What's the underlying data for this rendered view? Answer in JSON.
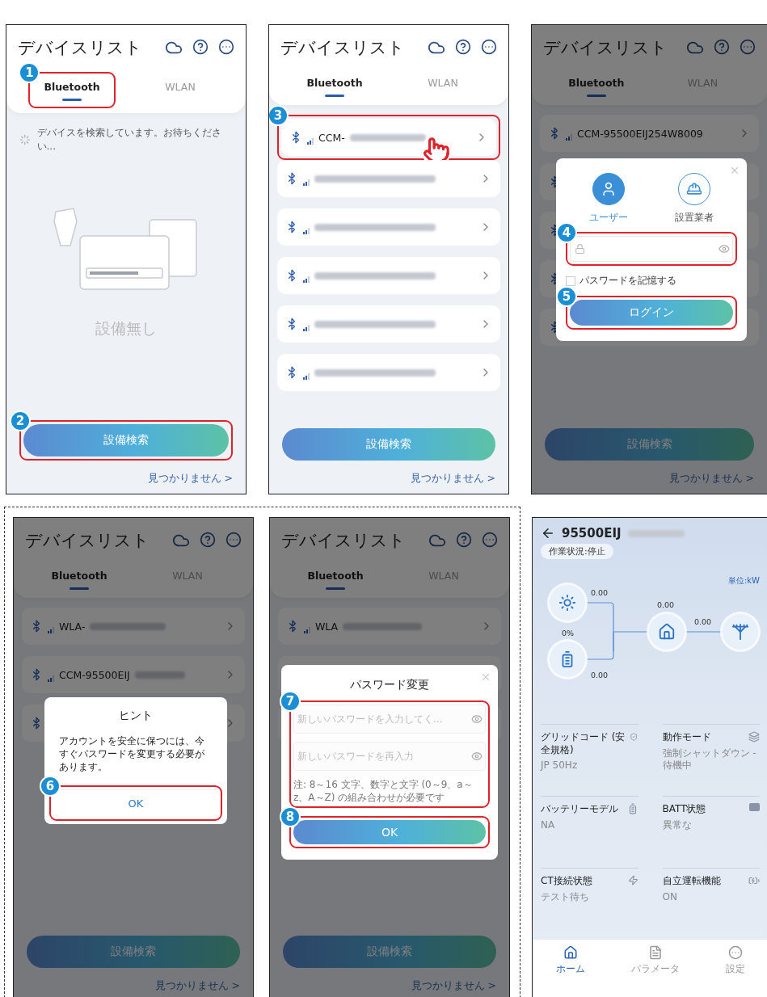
{
  "top_row": [
    {
      "kind": "device_list",
      "title": "デバイスリスト",
      "tabs": [
        {
          "label": "Bluetooth",
          "selected": true,
          "callout": "1"
        },
        {
          "label": "WLAN",
          "selected": false
        }
      ],
      "scanning_text": "デバイスを検索しています。お待ちください...",
      "empty_text": "設備無し",
      "search_button": {
        "label": "設備検索",
        "callout": "2"
      },
      "not_found_link": "見つかりません >"
    },
    {
      "kind": "device_list",
      "title": "デバイスリスト",
      "tabs": [
        {
          "label": "Bluetooth",
          "selected": true
        },
        {
          "label": "WLAN",
          "selected": false
        }
      ],
      "devices": [
        {
          "kind": "device",
          "name": "CCM-",
          "blurred": true,
          "callout": "3",
          "tapped": true
        },
        {
          "kind": "device",
          "blurred": true,
          "tapped": false
        },
        {
          "kind": "device",
          "blurred": true,
          "tapped": false
        },
        {
          "kind": "device",
          "blurred": true,
          "tapped": false
        },
        {
          "kind": "device",
          "blurred": true,
          "tapped": false
        },
        {
          "kind": "device",
          "blurred": true,
          "tapped": false
        }
      ],
      "search_button": {
        "label": "設備検索"
      },
      "not_found_link": "見つかりません >"
    },
    {
      "kind": "device_list",
      "title": "デバイスリスト",
      "tabs": [
        {
          "label": "Bluetooth",
          "selected": true
        },
        {
          "label": "WLAN",
          "selected": false
        }
      ],
      "devices": [
        {
          "kind": "device",
          "name": "CCM-95500EIJ254W8009",
          "blurred": false,
          "tapped": false
        },
        {
          "kind": "covered"
        },
        {
          "kind": "covered"
        },
        {
          "kind": "covered"
        },
        {
          "kind": "covered"
        }
      ],
      "search_button": {
        "label": "設備検索"
      },
      "not_found_link": "見つかりません >",
      "dialog": {
        "kind": "login",
        "roles": [
          {
            "label": "ユーザー",
            "selected": true
          },
          {
            "label": "設置業者",
            "selected": false
          }
        ],
        "password_field": {
          "callout": "4"
        },
        "remember": {
          "label": "パスワードを記憶する",
          "checked": false
        },
        "button": {
          "label": "ログイン",
          "callout": "5"
        }
      }
    }
  ],
  "bottom_row": {
    "grouped": [
      {
        "kind": "device_list",
        "title": "デバイスリスト",
        "tabs": [
          {
            "label": "Bluetooth",
            "selected": true
          },
          {
            "label": "WLAN",
            "selected": false
          }
        ],
        "devices": [
          {
            "kind": "device",
            "name": "WLA-",
            "blurred": true,
            "tapped": false
          },
          {
            "kind": "device",
            "name": "CCM-95500EIJ",
            "blurred": true,
            "tapped": false
          },
          {
            "kind": "covered"
          }
        ],
        "search_button": {
          "label": "設備検索"
        },
        "not_found_link": "見つかりません >",
        "dialog": {
          "kind": "hint",
          "title": "ヒント",
          "message": "アカウントを安全に保つには、今すぐパスワードを変更する必要があります。",
          "button": {
            "label": "OK",
            "callout": "6"
          }
        }
      },
      {
        "kind": "device_list",
        "title": "デバイスリスト",
        "tabs": [
          {
            "label": "Bluetooth",
            "selected": true
          },
          {
            "label": "WLAN",
            "selected": false
          }
        ],
        "devices": [
          {
            "kind": "device",
            "name": "WLA",
            "blurred": true,
            "tapped": false
          },
          {
            "kind": "covered"
          },
          {
            "kind": "covered"
          }
        ],
        "search_button": {
          "label": "設備検索"
        },
        "not_found_link": "見つかりません >",
        "dialog": {
          "kind": "password_change",
          "title": "パスワード変更",
          "fields": [
            {
              "placeholder": "新しいパスワードを入力してく..."
            },
            {
              "placeholder": "新しいパスワードを再入力"
            }
          ],
          "note": "注: 8～16 文字、数字と文字 (0～9、a～z、A～Z) の組み合わせが必要です",
          "fields_callout": "7",
          "button": {
            "label": "OK",
            "callout": "8"
          }
        }
      }
    ],
    "single": {
      "kind": "home",
      "device_id": "95500EIJ",
      "device_id_blurred": true,
      "status": "作業状況:停止",
      "unit": "単位:kW",
      "flow": {
        "pv": "0.00",
        "battery_soc": "0%",
        "battery": "0.00",
        "load": "0.00",
        "grid": "0.00"
      },
      "info": [
        {
          "label": "グリッドコード (安全規格)",
          "value": "JP 50Hz"
        },
        {
          "label": "動作モード",
          "value": "強制シャットダウン - 待機中"
        },
        {
          "label": "バッテリーモデル",
          "value": "NA"
        },
        {
          "label": "BATT状態",
          "value": "異常な"
        },
        {
          "label": "CT接続状態",
          "value": "テスト待ち"
        },
        {
          "label": "自立運転機能",
          "value": "ON"
        }
      ],
      "nav": [
        {
          "label": "ホーム",
          "selected": true
        },
        {
          "label": "パラメータ",
          "selected": false
        },
        {
          "label": "設定",
          "selected": false
        }
      ]
    }
  }
}
